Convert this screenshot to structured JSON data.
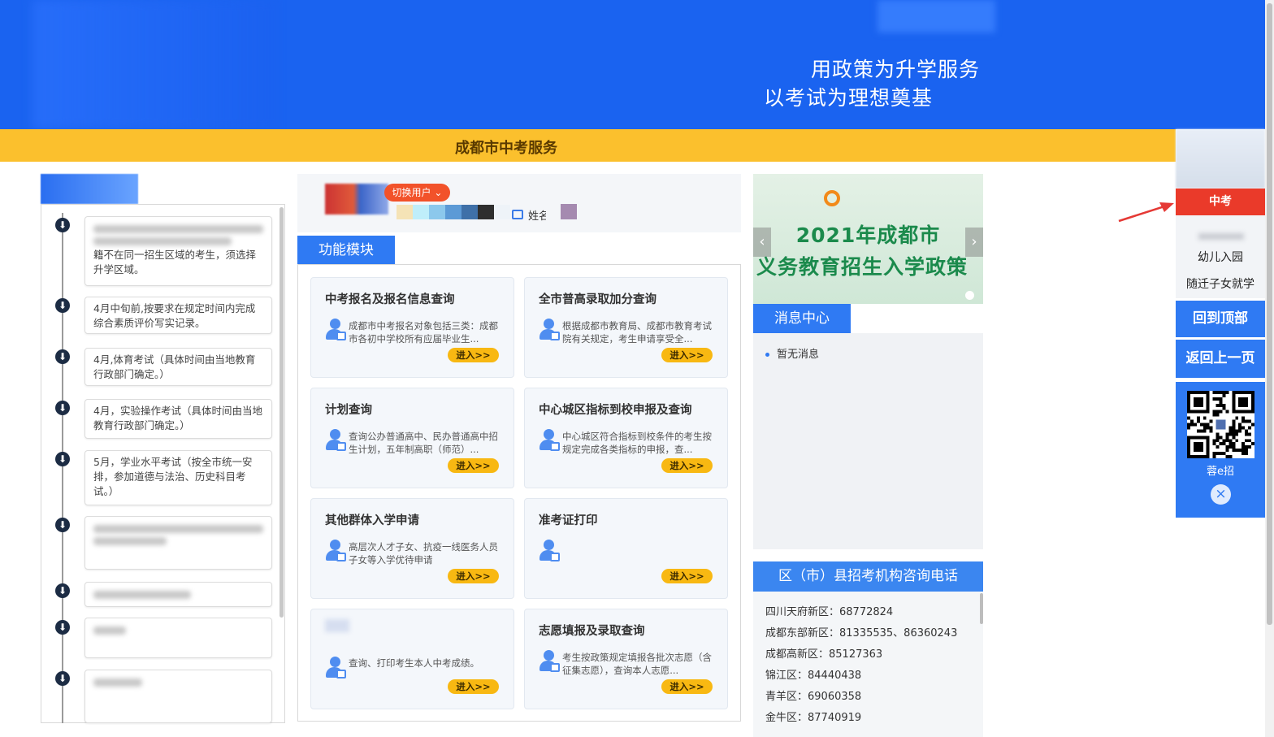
{
  "banner": {
    "slogan_line1": "用政策为升学服务",
    "slogan_line2": "以考试为理想奠基"
  },
  "section_title": "成都市中考服务",
  "timeline": {
    "items": [
      {
        "text": "籍不在同一招生区域的考生，须选择升学区域。",
        "blurred_prefix": true
      },
      {
        "text": "4月中旬前,按要求在规定时间内完成综合素质评价写实记录。"
      },
      {
        "text": "4月,体育考试（具体时间由当地教育行政部门确定。）"
      },
      {
        "text": "4月，实验操作考试（具体时间由当地教育行政部门确定。）"
      },
      {
        "text": "5月，学业水平考试（按全市统一安排，参加道德与法治、历史科目考试。）"
      }
    ]
  },
  "user": {
    "switch_label": "切换用户",
    "name_label": "姓名",
    "palette": [
      "#f5e3b6",
      "#bfeefa",
      "#8cc8ec",
      "#5c9ad6",
      "#3f70a8",
      "#2e2e2e",
      "#eef3f8"
    ]
  },
  "modules": {
    "tab_label": "功能模块",
    "enter_label": "进入>>",
    "cards": [
      {
        "title": "中考报名及报名信息查询",
        "desc": "成都市中考报名对象包括三类：成都市各初中学校所有应届毕业生..."
      },
      {
        "title": "全市普高录取加分查询",
        "desc": "根据成都市教育局、成都市教育考试院有关规定，考生申请享受全..."
      },
      {
        "title": "计划查询",
        "desc": "查询公办普通高中、民办普通高中招生计划，五年制高职（师范）..."
      },
      {
        "title": "中心城区指标到校申报及查询",
        "desc": "中心城区符合指标到校条件的考生按规定完成各类指标的申报，查..."
      },
      {
        "title": "其他群体入学申请",
        "desc": "高层次人才子女、抗疫一线医务人员子女等入学优待申请"
      },
      {
        "title": "准考证打印",
        "desc": ""
      },
      {
        "title": "",
        "desc": "查询、打印考生本人中考成绩。"
      },
      {
        "title": "志愿填报及录取查询",
        "desc": "考生按政策规定填报各批次志愿（含征集志愿），查询本人志愿..."
      }
    ]
  },
  "carousel": {
    "line1": "2021年成都市",
    "line2": "义务教育招生入学政策",
    "prev": "‹",
    "next": "›"
  },
  "messages": {
    "tab_label": "消息中心",
    "items": [
      "暂无消息"
    ]
  },
  "phones": {
    "header": "区（市）县招考机构咨询电话",
    "rows": [
      "四川天府新区：68772824",
      "成都东部新区：81335535、86360243",
      "成都高新区：85127363",
      "锦江区：84440438",
      "青羊区：69060358",
      "金牛区：87740919"
    ]
  },
  "sidebar": {
    "active": "中考",
    "items": [
      "幼儿入园",
      "随迁子女就学"
    ],
    "back_top": "回到顶部",
    "back_prev": "返回上一页",
    "qr_label": "蓉e招",
    "close": "×"
  },
  "colors": {
    "banner_blue": "#1a63f0",
    "section_yellow": "#fbc02d",
    "accent_blue": "#2f7af3",
    "enter_yellow": "#f8b812",
    "active_red": "#ea3a2a"
  }
}
